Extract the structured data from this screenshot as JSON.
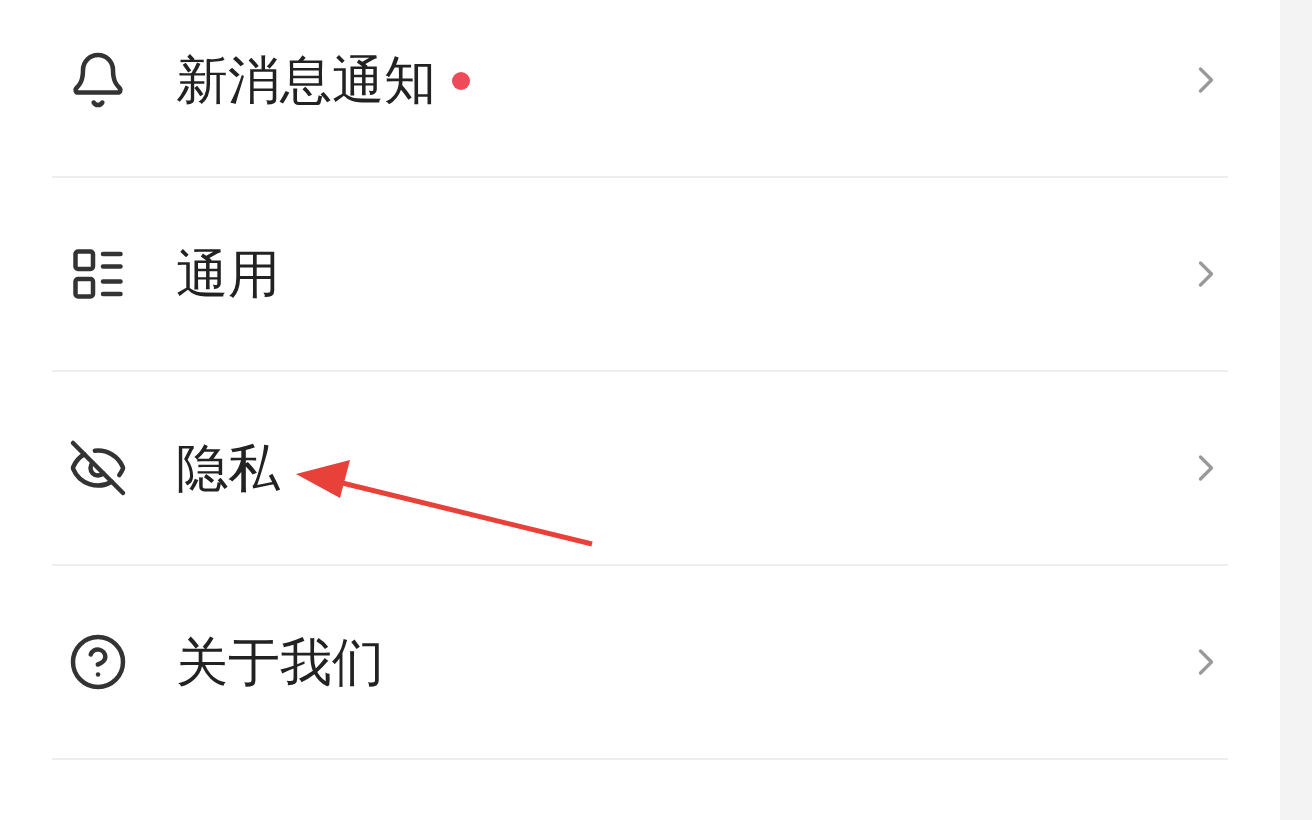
{
  "settings": [
    {
      "label": "新消息通知",
      "badge": true
    },
    {
      "label": "通用",
      "badge": false
    },
    {
      "label": "隐私",
      "badge": false
    },
    {
      "label": "关于我们",
      "badge": false
    }
  ]
}
